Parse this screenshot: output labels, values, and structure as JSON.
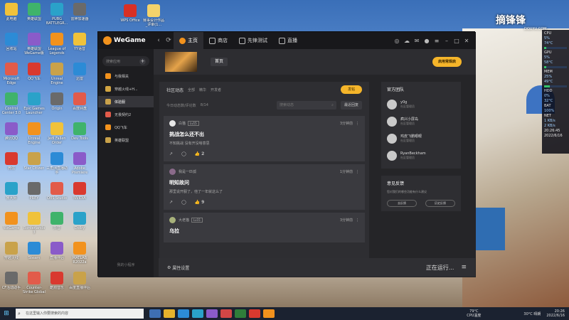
{
  "desktop": {
    "icons_col1": [
      "此电脑",
      "回收站",
      "Microsoft Edge",
      "Control Center 3.0",
      "腾讯QQ",
      "微信",
      "鲁大师",
      "WeGame",
      "穿越火线",
      "CF活动助手"
    ],
    "icons_col2": [
      "英雄联盟",
      "英雄联盟 WeGame版",
      "QQ飞车",
      "Epic Games Launcher",
      "Unreal Engine",
      "Star Citizen",
      "PREY",
      "Borderlands 3",
      "Steam",
      "Counter-Strike Global Off..."
    ],
    "icons_col3": [
      "PUBG BATTLEGR...",
      "League of Legends",
      "Unreal Engine",
      "Origin",
      "Jedi Fallen Order",
      "三角洲直播助手",
      "OBS Studio",
      "抖音",
      "直播伴侣",
      "酷狗音乐"
    ],
    "icons_col4": [
      "雷神加速器",
      "YY语音",
      "迅雷",
      "百度网盘",
      "Dev Tools",
      "Adobe Premiere",
      "NVIDIA",
      "Dolby",
      "MATLAB R2022a",
      "百度直播伴侣"
    ]
  },
  "right_icons": [
    "WPS Office",
    "赛事设计作品_评审(1..."
  ],
  "watermark": {
    "text": "摘锋锋",
    "sub": "DOUYU.COM"
  },
  "hwmon": [
    {
      "label": "CPU",
      "val": "5%",
      "temp": "74°C"
    },
    {
      "label": "GPU",
      "val": "5%",
      "temp": "58°C"
    },
    {
      "label": "MEM",
      "val": "25%",
      "temp": "49°C"
    },
    {
      "label": "HDD",
      "val": "0%",
      "temp": "32°C"
    },
    {
      "label": "BAT",
      "val": "100%",
      "temp": ""
    },
    {
      "label": "NET",
      "val": "1 KB/s",
      "temp": "2 KB/s"
    }
  ],
  "hw_clock": {
    "time": "20:26:45",
    "date": "2022/6/16"
  },
  "colors": {
    "accent": "#f5b52a",
    "bg": "#232326",
    "panel": "#2e2e32"
  },
  "app": {
    "name": "WeGame",
    "tabs": [
      {
        "label": "主页",
        "active": true
      },
      {
        "label": "商店"
      },
      {
        "label": "先锋测试"
      },
      {
        "label": "直播"
      }
    ]
  },
  "sidebar": {
    "search_placeholder": "搜索应用",
    "games": [
      {
        "label": "与我相关",
        "color": "#f2921d"
      },
      {
        "label": "穿越火线+H...",
        "color": "#d2a542"
      },
      {
        "label": "体验服",
        "color": "#caa24b",
        "active": true
      },
      {
        "label": "无畏契约2",
        "color": "#e25b4a"
      },
      {
        "label": "QQ飞车",
        "color": "#f2921d"
      },
      {
        "label": "英雄联盟",
        "color": "#c9a24a"
      }
    ],
    "footer": "我的小程序"
  },
  "banner": {
    "home_label": "首页",
    "launch_label": "启用常规启"
  },
  "feed": {
    "title": "社区动态",
    "filters": [
      "全部",
      "精华",
      "开发者"
    ],
    "post_label": "发帖",
    "stats": "今日动态数/评论数",
    "count": "8/14",
    "search_placeholder": "搜索动态",
    "sort": "最近回复",
    "posts": [
      {
        "user": "白猫",
        "level": "Lv15",
        "time": "3分钟前",
        "title": "挑战怎么还不出",
        "text": "不知挑战 没有开没啥意思",
        "likes": "2",
        "avatar": "#e7e7e7"
      },
      {
        "user": "我是一匹孤",
        "level": "",
        "time": "1分钟前",
        "title": "明知故问",
        "text": "那里说开服了，他了一年就这么了",
        "likes": "9",
        "avatar": "#8a6a8a"
      },
      {
        "user": "大老猫",
        "level": "Lv15",
        "time": "3分钟前",
        "title": "乌拉",
        "text": "",
        "likes": "",
        "avatar": "#a8b27b"
      }
    ]
  },
  "team": {
    "title": "官方团队",
    "members": [
      {
        "name": "y0g",
        "role": "社区管理员"
      },
      {
        "name": "疯兴小屏岛",
        "role": "社区管理员"
      },
      {
        "name": "鸡皮飞鹏眼眼",
        "role": "社区管理员"
      },
      {
        "name": "RyanBeckham",
        "role": "社区管理员"
      }
    ]
  },
  "feedback": {
    "title": "意见反馈",
    "text": "您对我们的哪些功能有什么建议",
    "btn1": "去反馈",
    "btn2": "历史反馈"
  },
  "bottom": {
    "settings": "属性设置",
    "running": "正在运行..."
  },
  "taskbar": {
    "search_placeholder": "在这里输入你要搜索的内容",
    "temp": "79°C",
    "temp_label": "CPU温度",
    "weather": "30°C 晴朗",
    "time": "20:26",
    "date": "2022/6/16"
  }
}
